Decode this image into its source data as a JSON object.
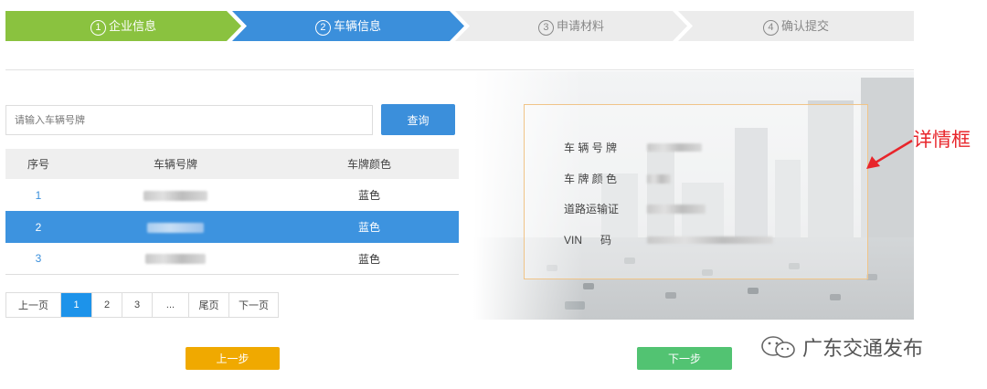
{
  "steps": [
    {
      "num": "1",
      "label": "企业信息",
      "state": "done",
      "color": "#8ac23f"
    },
    {
      "num": "2",
      "label": "车辆信息",
      "state": "current",
      "color": "#3b8fdb"
    },
    {
      "num": "3",
      "label": "申请材料",
      "state": "pending",
      "color": "#ececec"
    },
    {
      "num": "4",
      "label": "确认提交",
      "state": "pending",
      "color": "#ececec"
    }
  ],
  "search": {
    "placeholder": "请输入车辆号牌",
    "button_label": "查询"
  },
  "table": {
    "headers": [
      "序号",
      "车辆号牌",
      "车牌颜色"
    ],
    "rows": [
      {
        "index": "1",
        "plate": "(blurred)",
        "color": "蓝色",
        "selected": false
      },
      {
        "index": "2",
        "plate": "(blurred)",
        "color": "蓝色",
        "selected": true
      },
      {
        "index": "3",
        "plate": "(blurred)",
        "color": "蓝色",
        "selected": false
      }
    ]
  },
  "pagination": {
    "prev": "上一页",
    "pages": [
      "1",
      "2",
      "3",
      "..."
    ],
    "active_page": "1",
    "last": "尾页",
    "next": "下一页"
  },
  "detail": {
    "plate_label": "车 辆 号 牌",
    "color_label": "车 牌 颜 色",
    "license_label": "道路运输证",
    "vin_label": "VIN      码"
  },
  "buttons": {
    "prev_step": "上一步",
    "next_step": "下一步"
  },
  "annotation": "详情框",
  "watermark": "广东交通发布",
  "colors": {
    "accent_blue": "#3b8fdb",
    "done_green": "#8ac23f",
    "prev_orange": "#f0a900",
    "next_green": "#52c372",
    "detail_border": "#f0c488",
    "annotation_red": "#e8252b"
  }
}
